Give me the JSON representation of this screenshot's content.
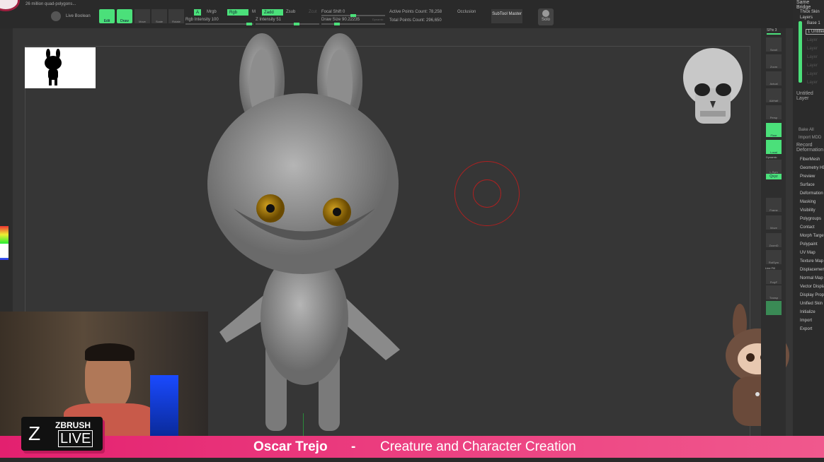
{
  "topbar": {
    "poly_info": "26 million quad-polygons...",
    "live_boolean": "Live Boolean",
    "edit": "Edit",
    "draw": "Draw",
    "move": "Move",
    "scale": "Scale",
    "rotate": "Rotate",
    "a": "A",
    "mrgb": "Mrgb",
    "rgb": "Rgb",
    "m": "M",
    "zadd": "Zadd",
    "zsub": "Zsub",
    "zcut": "Zcut",
    "rgb_intensity": "Rgb Intensity 100",
    "z_intensity": "Z Intensity 51",
    "focal_shift": "Focal Shift 0",
    "draw_size": "Draw Size 90.22235",
    "dynamic": "Dynamic",
    "active_points": "Active Points Count: 78,258",
    "total_points": "Total Points Count: 296,650",
    "occlusion": "Occlusion",
    "subtool_master": "SubTool Master",
    "solo": "Solo"
  },
  "shelf": {
    "spix": "SPix 3",
    "buttons": [
      "Scroll",
      "Zoom",
      "Actual",
      "AAHalf",
      "Persp",
      "Floor",
      "Local",
      "L.Sym",
      "Frame",
      "Move",
      "ZoomD",
      "RotSym",
      "PolyF",
      "Transp"
    ],
    "dynamic": "Dynamic",
    "xyz": "Qxyz",
    "line_fill": "Line Fill"
  },
  "rpanel": {
    "top": [
      "Same Bridge",
      "Thick Skin"
    ],
    "layers_title": "Layers",
    "base": "Base 1",
    "untitled": "1 Untitled",
    "layer_slots": [
      "Layer",
      "Layer",
      "Layer",
      "Layer",
      "Layer",
      "Layer"
    ],
    "untitled_layer": "Untitled Layer",
    "bake_all": "Bake All",
    "import_mdd": "Import MDD",
    "record": "Record Deformation",
    "menu": [
      "FiberMesh",
      "Geometry HD",
      "Preview",
      "Surface",
      "Deformation",
      "Masking",
      "Visibility",
      "Polygroups",
      "Contact",
      "Morph Target",
      "Polypaint",
      "UV Map",
      "Texture Map",
      "Displacement",
      "Normal Map",
      "Vector Displacement",
      "Display Properties",
      "Unified Skin",
      "Initialize",
      "Import",
      "Export"
    ]
  },
  "banner": {
    "name": "Oscar Trejo",
    "separator": "-",
    "title": "Creature and Character Creation",
    "logo_top": "ZBRUSH",
    "logo_bottom": "LIVE"
  },
  "colors": {
    "accent": "#4be07a",
    "banner": "#e3206f"
  }
}
